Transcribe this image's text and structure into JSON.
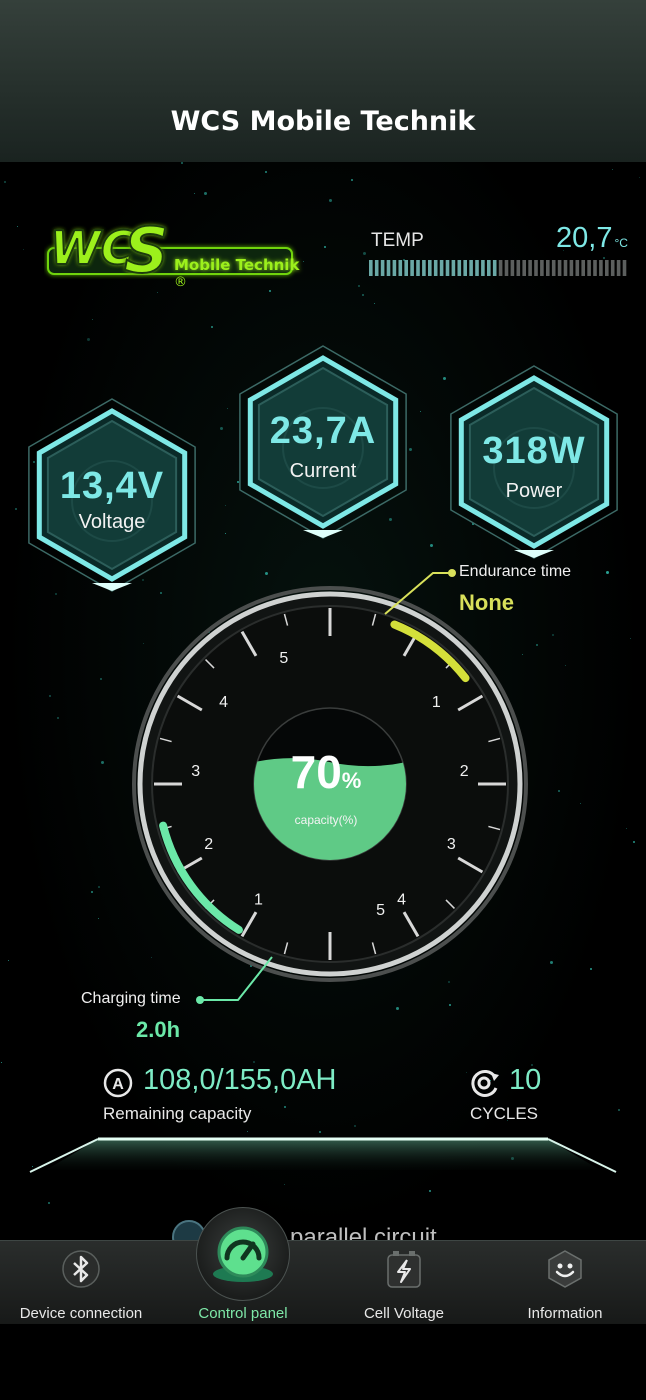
{
  "app": {
    "title": "WCS Mobile Technik"
  },
  "logo": {
    "brand": "WCS",
    "registered": "®",
    "subtitle": "Mobile Technik"
  },
  "temperature": {
    "label": "TEMP",
    "value": "20,7",
    "unit": "°C"
  },
  "metrics": [
    {
      "value": "13,4V",
      "label": "Voltage"
    },
    {
      "value": "23,7A",
      "label": "Current"
    },
    {
      "value": "318W",
      "label": "Power"
    }
  ],
  "gauge": {
    "percent": "70",
    "percent_sign": "%",
    "percent_fraction": 0.7,
    "sub_label": "capacity(%)",
    "left_ticks": [
      "5",
      "4",
      "3",
      "2",
      "1"
    ],
    "right_ticks": [
      "1",
      "2",
      "3",
      "4",
      "5"
    ]
  },
  "endurance": {
    "label": "Endurance time",
    "value": "None"
  },
  "charging": {
    "label": "Charging time",
    "value": "2.0h"
  },
  "capacity": {
    "icon": "capacity-icon",
    "value": "108,0/155,0AH",
    "label": "Remaining capacity"
  },
  "cycles": {
    "icon": "cycle-icon",
    "value": "10",
    "label": "CYCLES"
  },
  "partial_text": "parallel circuit",
  "tabs": [
    {
      "label": "Device connection",
      "icon": "bluetooth-icon"
    },
    {
      "label": "Control panel",
      "icon": "speedometer-icon",
      "active": true
    },
    {
      "label": "Cell Voltage",
      "icon": "battery-bolt-icon"
    },
    {
      "label": "Information",
      "icon": "smiley-icon"
    }
  ],
  "colors": {
    "accent_cyan": "#7ee8e6",
    "accent_green": "#6be8a8",
    "endurance_yellow": "#d8e05a",
    "logo_green": "#9cf01c",
    "background": "#000000"
  }
}
